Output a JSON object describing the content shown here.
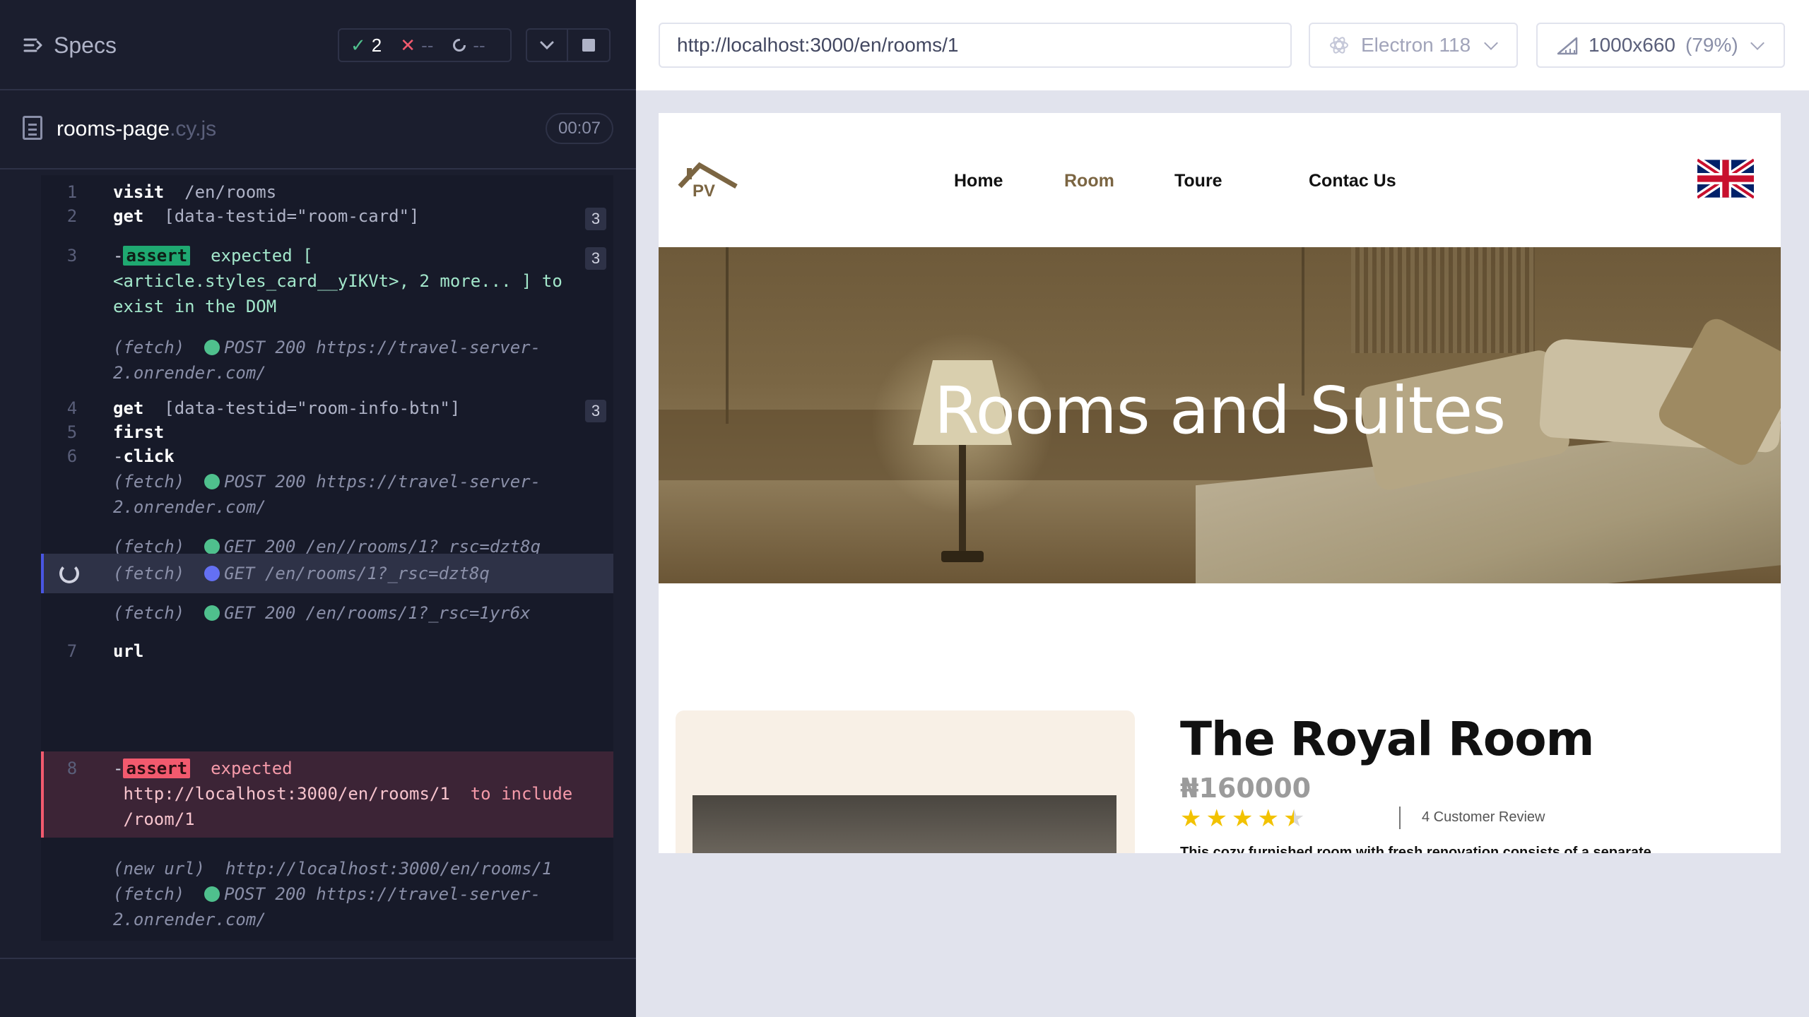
{
  "runner": {
    "specs_label": "Specs",
    "stats": {
      "passed": "2",
      "failed": "--",
      "pending": "--"
    },
    "file": {
      "name": "rooms-page",
      "ext": ".cy.js",
      "duration": "00:07"
    },
    "log": [
      {
        "num": "1",
        "name": "visit",
        "arg": "/en/rooms"
      },
      {
        "num": "2",
        "name": "get",
        "arg": "[data-testid=\"room-card\"]",
        "badge": "3"
      },
      {
        "num": "3",
        "kw": "assert",
        "line1": "expected [",
        "line2": "<article.styles_card__yIKVt>, 2 more... ] to",
        "line3": "exist in the DOM",
        "badge": "3"
      },
      {
        "fetch": "(fetch)",
        "req1": "POST 200 https://travel-server-",
        "req2": "2.onrender.com/"
      },
      {
        "num": "4",
        "name": "get",
        "arg": "[data-testid=\"room-info-btn\"]",
        "badge": "3"
      },
      {
        "num": "5",
        "name": "first"
      },
      {
        "num": "6",
        "name": "click"
      },
      {
        "fetch": "(fetch)",
        "req1": "POST 200 https://travel-server-",
        "req2": "2.onrender.com/"
      },
      {
        "fetch": "(fetch)",
        "req": "GET 200 /en//rooms/1?_rsc=dzt8q"
      },
      {
        "fetch": "(fetch)",
        "req": "GET /en/rooms/1?_rsc=dzt8q"
      },
      {
        "fetch": "(fetch)",
        "req": "GET 200 /en/rooms/1?_rsc=1yr6x"
      },
      {
        "num": "7",
        "name": "url"
      },
      {
        "num": "8",
        "kw": "assert",
        "line1": "expected",
        "url": "http://localhost:3000/en/rooms/1",
        "to_include": "to include",
        "line3": "/room/1"
      },
      {
        "fetch": "(new url)",
        "req": "http://localhost:3000/en/rooms/1"
      },
      {
        "fetch": "(fetch)",
        "req1": "POST 200 https://travel-server-",
        "req2": "2.onrender.com/"
      }
    ]
  },
  "aut": {
    "url": "http://localhost:3000/en/rooms/1",
    "browser": "Electron 118",
    "viewport": "1000x660",
    "zoom": "(79%)"
  },
  "site": {
    "logo_text": "PV",
    "nav": [
      "Home",
      "Room",
      "Toure",
      "Contac Us"
    ],
    "hero_title": "Rooms and Suites",
    "room": {
      "title": "The Royal Room",
      "price": "₦160000",
      "rating": 4.5,
      "reviews": "4 Customer Review",
      "desc": "This cozy furnished room with fresh renovation consists of a separate"
    }
  },
  "colors": {
    "accent": "#4956e3",
    "pass": "#4fc08d",
    "fail": "#f25a6e",
    "nav_active": "#7b6542"
  }
}
